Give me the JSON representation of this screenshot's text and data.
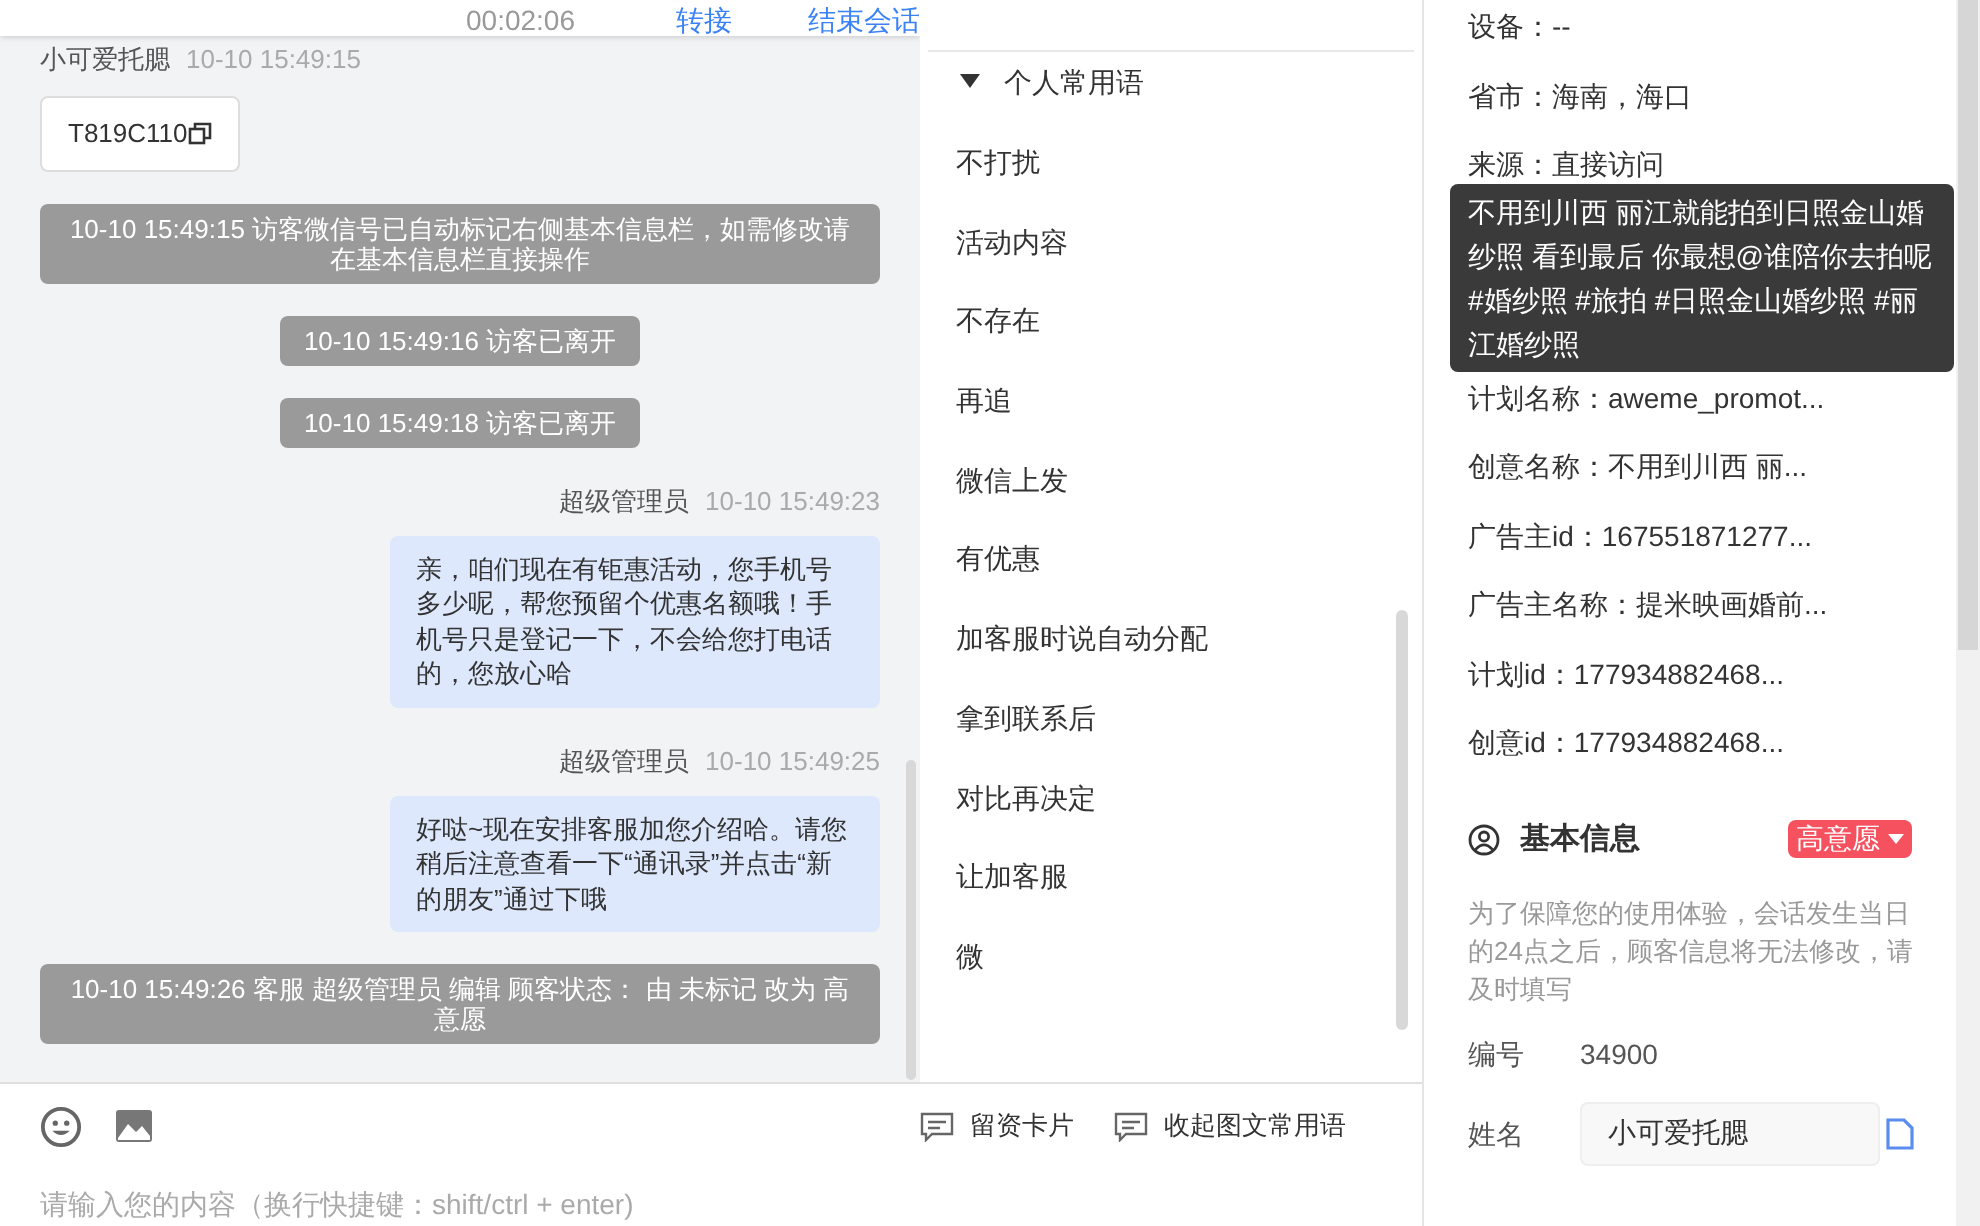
{
  "header": {
    "timer": "00:02:06",
    "actions": [
      "转接",
      "结束会话"
    ]
  },
  "messages": [
    {
      "kind": "visitor",
      "sender": "小可爱托腮",
      "time": "10-10 15:49:15",
      "text": "T819C110"
    },
    {
      "kind": "system",
      "text": "10-10 15:49:15 访客微信号已自动标记右侧基本信息栏，如需修改请在基本信息栏直接操作"
    },
    {
      "kind": "system",
      "text": "10-10 15:49:16 访客已离开"
    },
    {
      "kind": "system",
      "text": "10-10 15:49:18 访客已离开"
    },
    {
      "kind": "agent",
      "sender": "超级管理员",
      "time": "10-10 15:49:23",
      "text": "亲，咱们现在有钜惠活动，您手机号多少呢，帮您预留个优惠名额哦！手机号只是登记一下，不会给您打电话的，您放心哈"
    },
    {
      "kind": "agent",
      "sender": "超级管理员",
      "time": "10-10 15:49:25",
      "text": "好哒~现在安排客服加您介绍哈。请您稍后注意查看一下“通讯录”并点击“新的朋友”通过下哦"
    },
    {
      "kind": "system",
      "text": "10-10 15:49:26 客服 超级管理员 编辑 顾客状态： 由 未标记 改为 高意愿"
    }
  ],
  "phrases": {
    "title": "个人常用语",
    "expanded": true,
    "items": [
      "不打扰",
      "活动内容",
      "不存在",
      "再追",
      "微信上发",
      "有优惠",
      "加客服时说自动分配",
      "拿到联系后",
      "对比再决定",
      "让加客服",
      "微"
    ]
  },
  "composer": {
    "placeholder": "请输入您的内容（换行快捷键：shift/ctrl + enter)",
    "buttons": [
      "留资卡片",
      "收起图文常用语"
    ]
  },
  "info": {
    "rows_top": [
      "设备：--",
      "省市：海南，海口",
      "来源：直接访问"
    ],
    "tooltip": "不用到川西 丽江就能拍到日照金山婚纱照 看到最后 你最想@谁陪你去拍呢 #婚纱照 #旅拍 #日照金山婚纱照 #丽江婚纱照",
    "rows": [
      "计划名称：aweme_promot...",
      "创意名称：不用到川西 丽...",
      "广告主id：167551871277...",
      "广告主名称：提米映画婚前...",
      "计划id：177934882468...",
      "创意id：177934882468..."
    ]
  },
  "basic_info": {
    "title": "基本信息",
    "tag": {
      "text": "高意愿",
      "color": "#f5515f"
    },
    "notice": "为了保障您的使用体验，会话发生当日的24点之后，顾客信息将无法修改，请及时填写",
    "fields": [
      {
        "kind": "text",
        "label": "编号",
        "value": "34900"
      },
      {
        "kind": "input",
        "label": "姓名",
        "value": "小可爱托腮"
      }
    ]
  }
}
